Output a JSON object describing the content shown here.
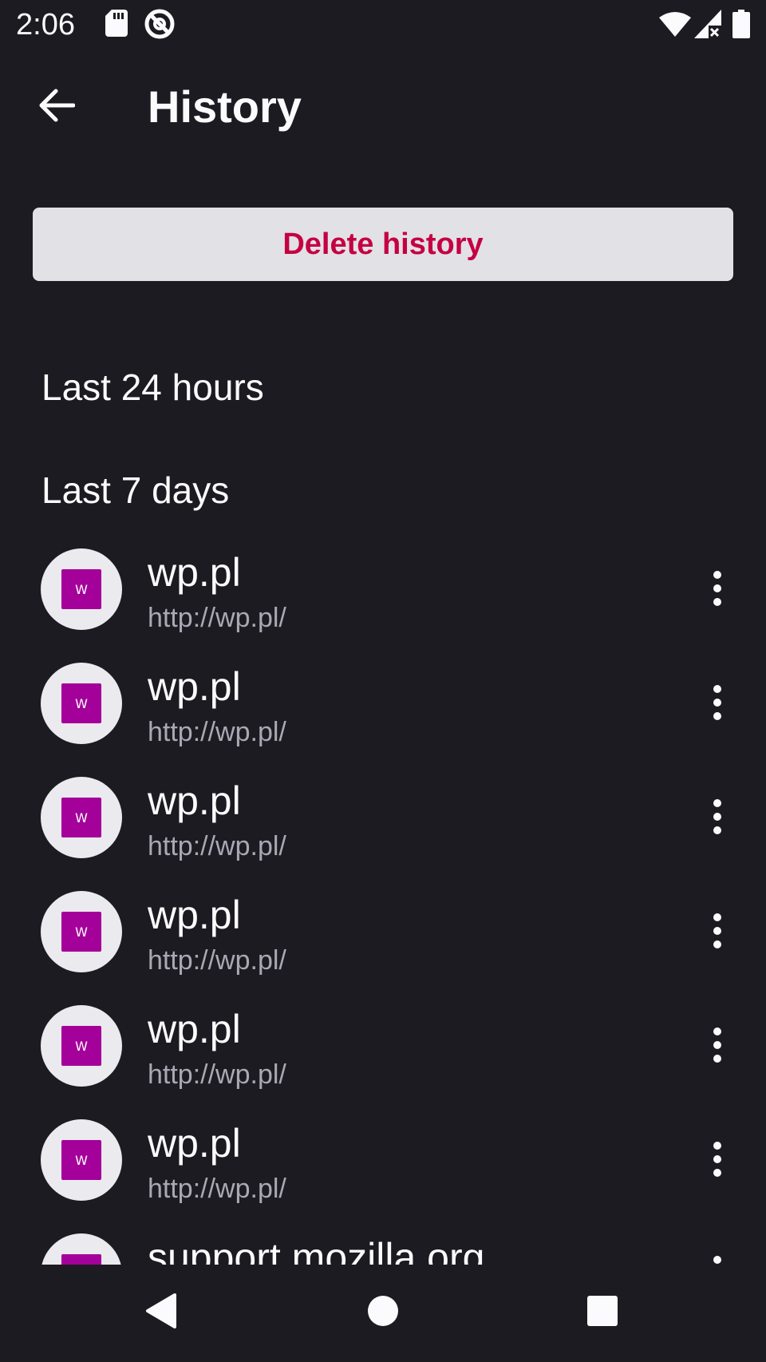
{
  "status_bar": {
    "time": "2:06",
    "icons": [
      "sd-card-icon",
      "at-sign-icon",
      "wifi-icon",
      "signal-no-data-icon",
      "battery-icon"
    ]
  },
  "toolbar": {
    "title": "History",
    "back_icon": "arrow-back-icon"
  },
  "delete_button": {
    "label": "Delete history"
  },
  "sections": {
    "last_24_hours": "Last 24 hours",
    "last_7_days": "Last 7 days"
  },
  "history_items": [
    {
      "title": "wp.pl",
      "url": "http://wp.pl/",
      "favicon_letter": "W"
    },
    {
      "title": "wp.pl",
      "url": "http://wp.pl/",
      "favicon_letter": "W"
    },
    {
      "title": "wp.pl",
      "url": "http://wp.pl/",
      "favicon_letter": "W"
    },
    {
      "title": "wp.pl",
      "url": "http://wp.pl/",
      "favicon_letter": "W"
    },
    {
      "title": "wp.pl",
      "url": "http://wp.pl/",
      "favicon_letter": "W"
    },
    {
      "title": "wp.pl",
      "url": "http://wp.pl/",
      "favicon_letter": "W"
    },
    {
      "title": "support.mozilla.org",
      "url": "",
      "favicon_letter": ""
    }
  ],
  "colors": {
    "background": "#1c1b22",
    "button_bg": "#e2e1e6",
    "button_text": "#c50042",
    "favicon_bg": "#a4009a",
    "favicon_circle": "#ebeaee",
    "url_text": "#a9a8b3"
  },
  "nav_bar": {
    "icons": [
      "back-triangle-icon",
      "home-circle-icon",
      "recents-square-icon"
    ]
  }
}
